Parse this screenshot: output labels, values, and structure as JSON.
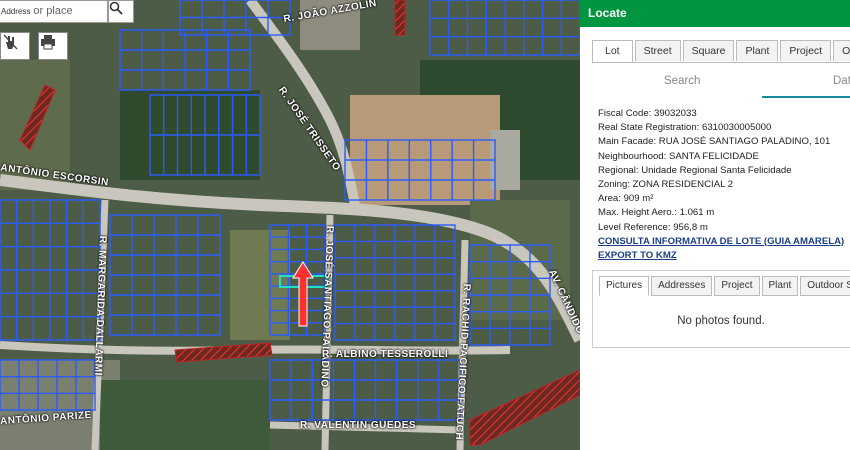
{
  "map": {
    "search_text": "Address",
    "search_placeholder": "or place",
    "icons": {
      "search": "search-icon",
      "touch": "touch-hand-icon",
      "print": "printer-icon"
    },
    "road_labels": [
      "R. JOÃO AZZOLIN",
      "R. JOSÉ TRISSETO",
      "ANTÔNIO ESCORSIN",
      "R. MARGARIDA DALLARMI",
      "R. JOSÉ SANTIAGO PALADINO",
      "R. ALBINO TESSEROLLI",
      "R. RACHID PACIFICO FATUCH",
      "AV. CÂNDIDO",
      "ANTÔNIO PARIZE",
      "R. VALENTIN GUEDES"
    ],
    "colors": {
      "lot_lines": "#2a5cff",
      "highlight": "#20e0c0",
      "arrow": "#ff2020",
      "hatch": "#c02020"
    }
  },
  "panel": {
    "title": "Locate",
    "header_color": "#00963f",
    "tabs": [
      "Lot",
      "Street",
      "Square",
      "Plant",
      "Project",
      "Out"
    ],
    "subtabs": {
      "search": "Search",
      "data": "Dat"
    },
    "details": {
      "fiscal_code": "Fiscal Code: 39032033",
      "real_state": "Real State Registration: 6310030005000",
      "main_facade": "Main Facade: RUA JOSÉ SANTIAGO PALADINO, 101",
      "neighbourhood": "Neighbourhood: SANTA FELICIDADE",
      "regional": "Regional: Unidade Regional Santa Felicidade",
      "zoning": "Zoning: ZONA RESIDENCIAL 2",
      "area": "Area: 909 m²",
      "max_height": "Max. Height Aero.: 1.061 m",
      "level_reference": "Level Reference: 956,8 m",
      "link_consulta": "CONSULTA INFORMATIVA DE LOTE (GUIA AMARELA)",
      "link_kmz": "EXPORT TO KMZ"
    },
    "inner_tabs": [
      "Pictures",
      "Addresses",
      "Project",
      "Plant",
      "Outdoor S"
    ],
    "no_photos": "No photos found."
  }
}
